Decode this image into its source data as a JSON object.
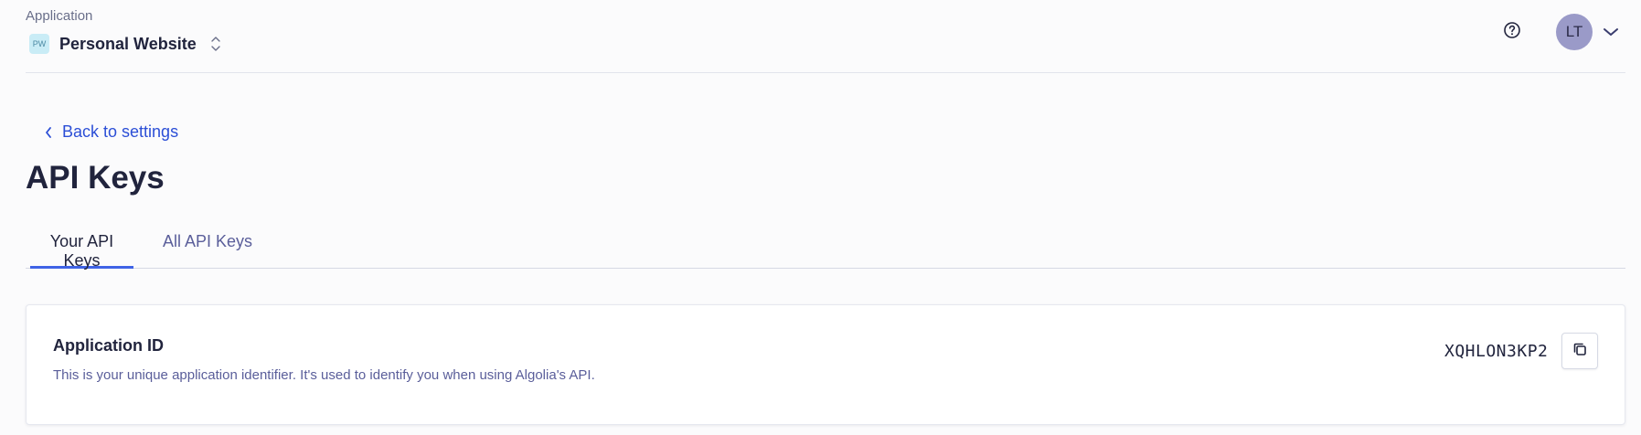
{
  "header": {
    "app_label": "Application",
    "app_initials": "PW",
    "app_name": "Personal Website",
    "user_initials": "LT"
  },
  "navigation": {
    "back_label": "Back to settings"
  },
  "page": {
    "title": "API Keys"
  },
  "tabs": [
    {
      "label": "Your API Keys",
      "active": true
    },
    {
      "label": "All API Keys",
      "active": false
    }
  ],
  "application_id_card": {
    "title": "Application ID",
    "description": "This is your unique application identifier. It's used to identify you when using Algolia's API.",
    "value": "XQHLON3KP2"
  },
  "icons": {
    "app_switcher": "updown-chevron-icon",
    "help": "question-circle-icon",
    "user_menu": "chevron-down-icon",
    "back": "chevron-left-icon",
    "copy": "copy-icon"
  },
  "colors": {
    "accent": "#3f63e6",
    "link": "#2b4ed6",
    "text": "#21243d",
    "muted_text": "#5a5e9a",
    "avatar_bg": "#9a9ac8",
    "app_avatar_bg": "#c9ecf6"
  }
}
